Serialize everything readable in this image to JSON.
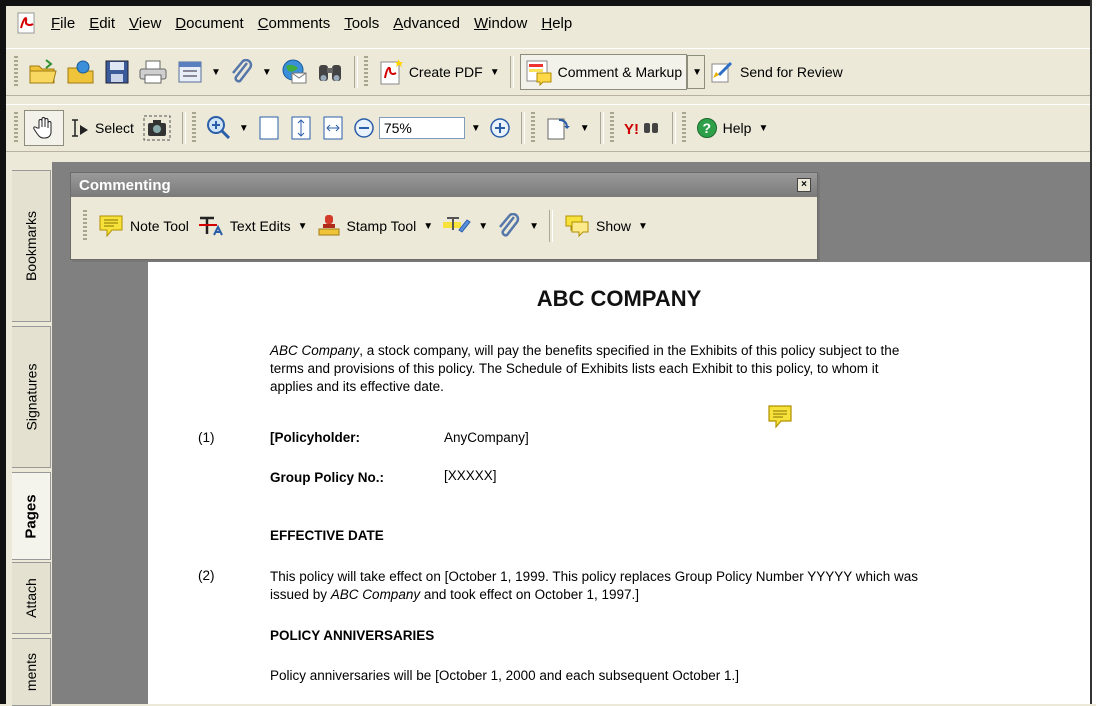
{
  "menu": {
    "items": [
      {
        "label": "File",
        "mnemonic": "F",
        "rest": "ile"
      },
      {
        "label": "Edit",
        "mnemonic": "E",
        "rest": "dit"
      },
      {
        "label": "View",
        "mnemonic": "V",
        "rest": "iew"
      },
      {
        "label": "Document",
        "mnemonic": "D",
        "rest": "ocument"
      },
      {
        "label": "Comments",
        "mnemonic": "C",
        "rest": "omments"
      },
      {
        "label": "Tools",
        "mnemonic": "T",
        "rest": "ools"
      },
      {
        "label": "Advanced",
        "mnemonic": "A",
        "rest": "dvanced"
      },
      {
        "label": "Window",
        "mnemonic": "W",
        "rest": "indow"
      },
      {
        "label": "Help",
        "mnemonic": "H",
        "rest": "elp"
      }
    ]
  },
  "toolbar1": {
    "create_pdf": "Create PDF",
    "comment_markup": "Comment & Markup",
    "send_review": "Send for Review"
  },
  "toolbar2": {
    "select": "Select",
    "zoom_value": "75%",
    "help": "Help"
  },
  "side_tabs": {
    "bookmarks": "Bookmarks",
    "signatures": "Signatures",
    "pages": "Pages",
    "attachments": "Attach",
    "comments": "ments"
  },
  "commenting": {
    "title": "Commenting",
    "close": "×",
    "note_tool": "Note Tool",
    "text_edits": "Text Edits",
    "stamp_tool": "Stamp Tool",
    "show": "Show"
  },
  "document": {
    "title": "ABC COMPANY",
    "intro_italic": "ABC Company",
    "intro_line1": ", a stock company, will pay the benefits specified in the Exhibits of this policy subject to the",
    "intro_line2": "terms and provisions of this policy.  The Schedule of Exhibits lists each Exhibit to this policy, to whom it",
    "intro_line3": "applies and its effective date.",
    "item1_num": "(1)",
    "policyholder_label": "[Policyholder:",
    "policyholder_value": "AnyCompany]",
    "group_policy_label": "Group Policy No.:",
    "group_policy_value": "[XXXXX]",
    "effective_heading": "EFFECTIVE DATE",
    "item2_num": "(2)",
    "effective_line1": "This policy will take effect on [October 1, 1999.  This policy replaces Group Policy Number YYYYY which was",
    "effective_line2a": "issued by ",
    "effective_line2_italic": "ABC Company",
    "effective_line2b": " and took effect on October 1, 1997.]",
    "anniv_heading": "POLICY ANNIVERSARIES",
    "anniv_text": "Policy anniversaries will be [October 1, 2000 and each subsequent October 1.]"
  },
  "colors": {
    "chrome": "#ece9d8",
    "doc_background": "#808080",
    "note_yellow": "#f7e23b",
    "accent_red": "#cc2222"
  }
}
